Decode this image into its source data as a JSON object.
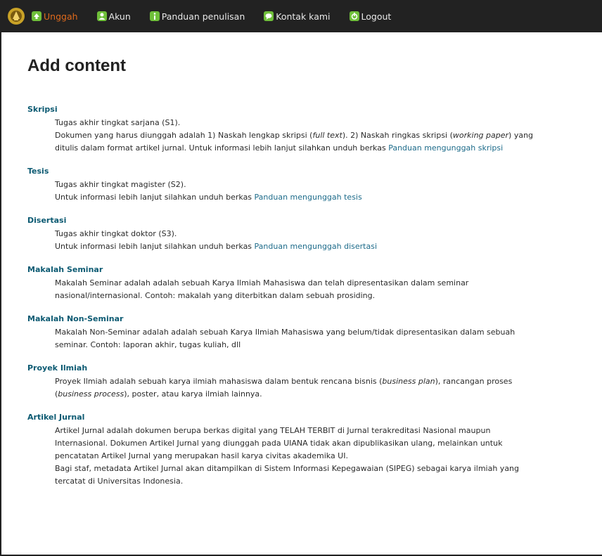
{
  "nav": {
    "items": [
      {
        "label": "Unggah",
        "icon": "upload-icon",
        "active": true
      },
      {
        "label": "Akun",
        "icon": "user-icon",
        "active": false
      },
      {
        "label": "Panduan penulisan",
        "icon": "guide-icon",
        "active": false
      },
      {
        "label": "Kontak kami",
        "icon": "contact-icon",
        "active": false
      },
      {
        "label": "Logout",
        "icon": "logout-icon",
        "active": false
      }
    ],
    "active_color": "#e06a1c"
  },
  "page_title": "Add content",
  "entries": {
    "skripsi": {
      "title": "Skripsi",
      "line1": "Tugas akhir tingkat sarjana (S1).",
      "line2_a": "Dokumen yang harus diunggah adalah 1) Naskah lengkap skripsi (",
      "line2_b": "full text",
      "line2_c": "). 2) Naskah ringkas skripsi (",
      "line2_d": "working paper",
      "line2_e": ") yang",
      "line3_a": "ditulis dalam format artikel jurnal. Untuk informasi lebih lanjut silahkan unduh berkas ",
      "link": "Panduan mengunggah skripsi"
    },
    "tesis": {
      "title": "Tesis",
      "line1": "Tugas akhir tingkat magister (S2).",
      "line2_a": "Untuk informasi lebih lanjut silahkan unduh berkas ",
      "link": "Panduan mengunggah tesis"
    },
    "disertasi": {
      "title": "Disertasi",
      "line1": "Tugas akhir tingkat doktor (S3).",
      "line2_a": "Untuk informasi lebih lanjut silahkan unduh berkas ",
      "link": "Panduan mengunggah disertasi"
    },
    "makalah_seminar": {
      "title": "Makalah Seminar",
      "line1": "Makalah Seminar adalah adalah sebuah Karya Ilmiah Mahasiswa dan telah dipresentasikan dalam seminar",
      "line2": "nasional/internasional. Contoh: makalah yang diterbitkan dalam sebuah prosiding."
    },
    "makalah_non_seminar": {
      "title": "Makalah Non-Seminar",
      "line1": "Makalah Non-Seminar adalah adalah sebuah Karya Ilmiah Mahasiswa yang belum/tidak dipresentasikan dalam sebuah",
      "line2": "seminar. Contoh: laporan akhir, tugas kuliah, dll"
    },
    "proyek_ilmiah": {
      "title": "Proyek Ilmiah",
      "line1_a": "Proyek Ilmiah adalah sebuah karya ilmiah mahasiswa dalam bentuk rencana bisnis (",
      "line1_b": "business plan",
      "line1_c": "), rancangan proses",
      "line2_a": "(",
      "line2_b": "business process",
      "line2_c": "), poster, atau karya ilmiah lainnya."
    },
    "artikel_jurnal": {
      "title": "Artikel Jurnal",
      "line1": "Artikel Jurnal adalah dokumen berupa berkas digital yang TELAH TERBIT di Jurnal terakreditasi Nasional maupun",
      "line2": "Internasional. Dokumen Artikel Jurnal yang diunggah pada UIANA tidak akan dipublikasikan ulang, melainkan untuk",
      "line3": "pencatatan Artikel Jurnal yang merupakan hasil karya civitas akademika UI.",
      "line4": "Bagi staf, metadata Artikel Jurnal akan ditampilkan di Sistem Informasi Kepegawaian (SIPEG) sebagai karya ilmiah yang",
      "line5": "tercatat di Universitas Indonesia."
    }
  }
}
